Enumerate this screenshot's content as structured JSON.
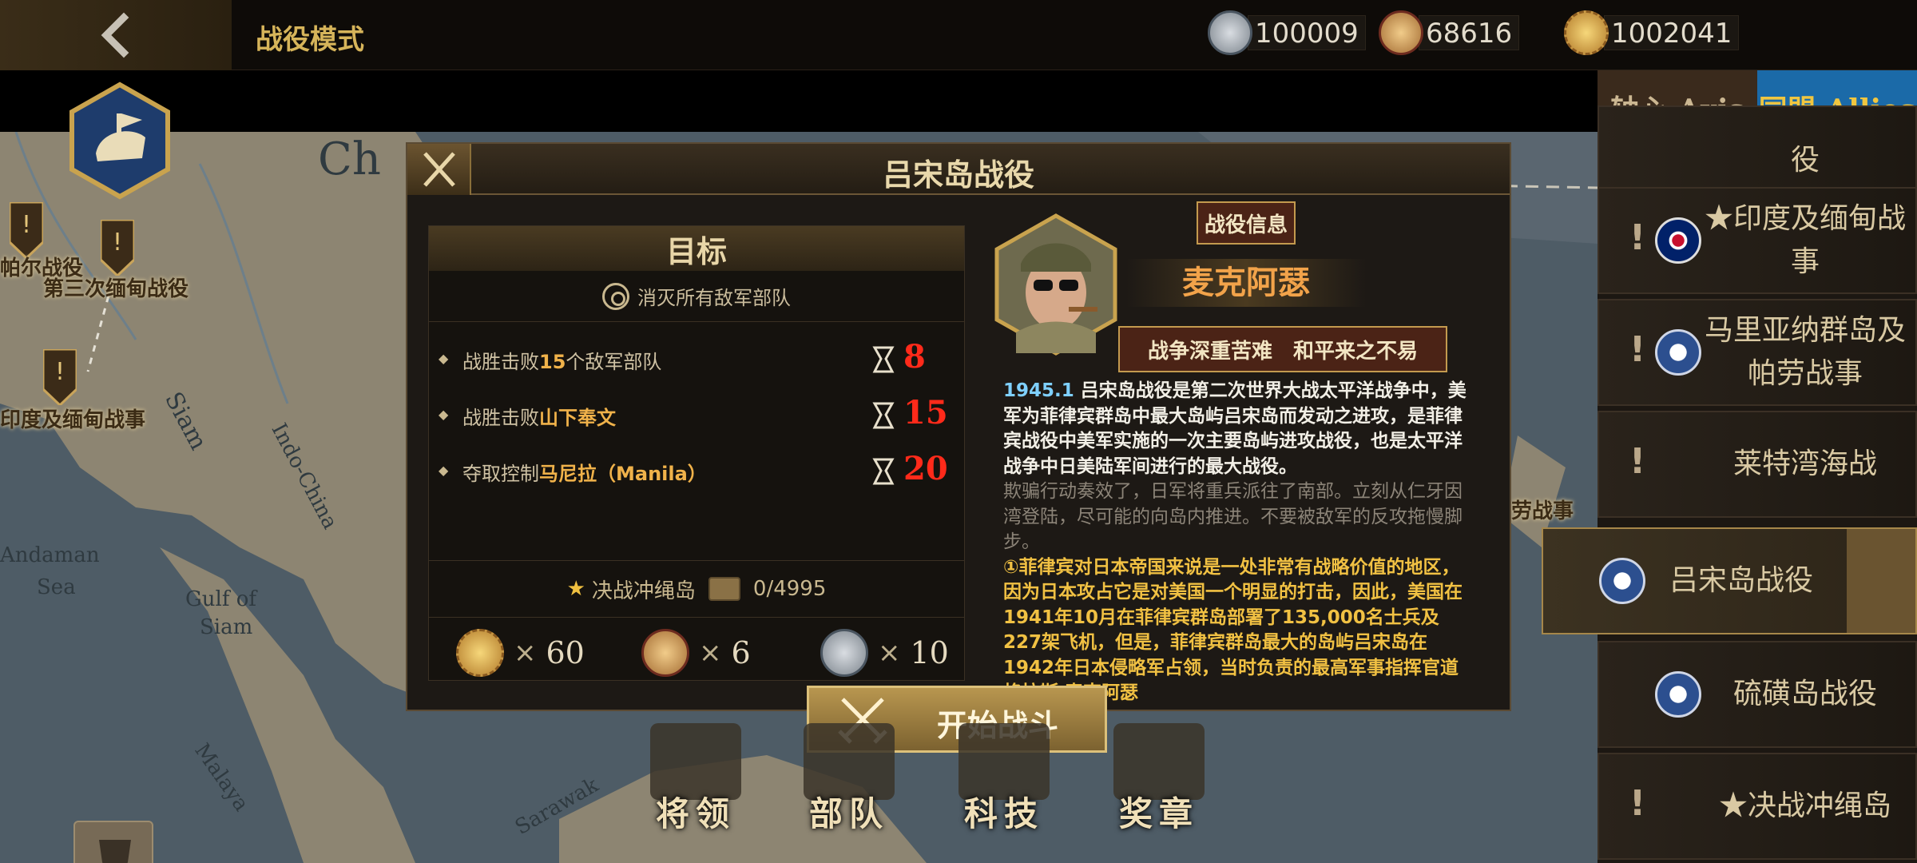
{
  "topbar": {
    "mode_title": "战役模式",
    "currencies": [
      {
        "icon": "silver-medal-icon",
        "value": "100009"
      },
      {
        "icon": "bronze-medal-icon",
        "value": "68616"
      },
      {
        "icon": "gold-sun-medal-icon",
        "value": "1002041"
      }
    ]
  },
  "side": {
    "tabs": [
      {
        "label": "轴心 Axis"
      },
      {
        "label": "同盟 Allies"
      }
    ],
    "items": [
      {
        "label": "役",
        "flag": "us-star-flag-icon"
      },
      {
        "label": "★印度及缅甸战事",
        "flag": "uk-flag-icon"
      },
      {
        "label": "马里亚纳群岛及帕劳战事",
        "flag": "us-star-flag-icon"
      },
      {
        "label": "莱特湾海战",
        "flag": "us-star-flag-icon"
      },
      {
        "label": "吕宋岛战役",
        "flag": "us-star-flag-icon"
      },
      {
        "label": "硫磺岛战役",
        "flag": "us-star-flag-icon"
      },
      {
        "label": "★决战冲绳岛",
        "flag": "us-star-flag-icon"
      }
    ]
  },
  "map": {
    "labels": {
      "china": "Ch",
      "indochina": "Indo-China",
      "siam": "Siam",
      "andaman": "Andaman",
      "sea": "Sea",
      "gulf": "Gulf of",
      "siam2": "Siam",
      "malaya": "Malaya",
      "sarawak": "Sarawak"
    },
    "markers": [
      {
        "label": "帕尔战役"
      },
      {
        "label": "第三次缅甸战役"
      },
      {
        "label": "印度及缅甸战事"
      },
      {
        "label": "及帕劳战事"
      }
    ]
  },
  "dialog": {
    "title": "吕宋岛战役",
    "objective": {
      "header": "目标",
      "subtitle": "消灭所有敌军部队",
      "rows": [
        {
          "prefix": "战胜击败",
          "highlight": "15",
          "suffix": "个敌军部队",
          "value": "8"
        },
        {
          "prefix": "战胜击败",
          "highlight": "山下奉文",
          "suffix": "",
          "value": "15"
        },
        {
          "prefix": "夺取控制",
          "highlight": "马尼拉（Manila）",
          "suffix": "",
          "value": "20"
        }
      ],
      "final_battle": "决战冲绳岛",
      "final_progress": "0/4995",
      "rewards": [
        {
          "icon": "gold-sun-medal-icon",
          "mult": "×",
          "count": "60"
        },
        {
          "icon": "bronze-medal-icon",
          "mult": "×",
          "count": "6"
        },
        {
          "icon": "silver-medal-icon",
          "mult": "×",
          "count": "10"
        }
      ]
    },
    "info_tag": "战役信息",
    "general_name": "麦克阿瑟",
    "motto": "战争深重苦难　和平来之不易",
    "desc": {
      "year": "1945.1",
      "p1": "吕宋岛战役是第二次世界大战太平洋战争中，美军为菲律宾群岛中最大岛屿吕宋岛而发动之进攻，是菲律宾战役中美军实施的一次主要岛屿进攻战役，也是太平洋战争中日美陆军间进行的最大战役。",
      "p2": "欺骗行动奏效了，日军将重兵派往了南部。立刻从仁牙因湾登陆，尽可能的向岛内推进。不要被敌军的反攻拖慢脚步。",
      "p3": "①菲律宾对日本帝国来说是一处非常有战略价值的地区，因为日本攻占它是对美国一个明显的打击，因此，美国在1941年10月在菲律宾群岛部署了135,000名士兵及227架飞机，但是，菲律宾群岛最大的岛屿吕宋岛在1942年日本侵略军占领，当时负责的最高军事指挥官道格拉斯 麦克阿瑟"
    },
    "start_button": "开始战斗"
  },
  "bottom_nav": [
    {
      "label": "将领"
    },
    {
      "label": "部队"
    },
    {
      "label": "科技"
    },
    {
      "label": "奖章"
    }
  ]
}
